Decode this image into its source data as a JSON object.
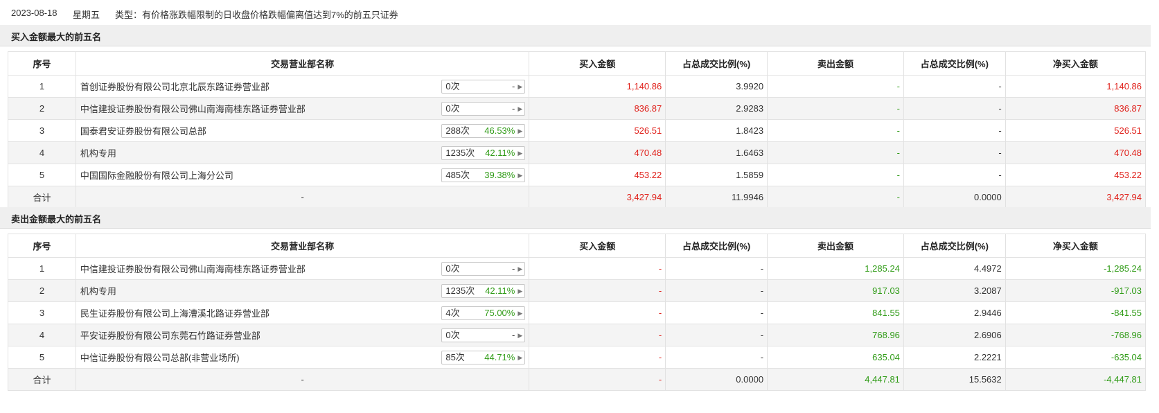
{
  "header": {
    "date": "2023-08-18",
    "weekday": "星期五",
    "type_text": "类型：有价格涨跌幅限制的日收盘价格跌幅偏离值达到7%的前五只证券"
  },
  "columns": [
    "序号",
    "交易营业部名称",
    "买入金额",
    "占总成交比例(%)",
    "卖出金额",
    "占总成交比例(%)",
    "净买入金额"
  ],
  "buy_section": {
    "title": "买入金额最大的前五名",
    "rows": [
      {
        "rank": "1",
        "name": "首创证券股份有限公司北京北辰东路证券营业部",
        "count": "0次",
        "pct": "-",
        "buy": "1,140.86",
        "buy_ratio": "3.9920",
        "sell": "-",
        "sell_ratio": "-",
        "net": "1,140.86"
      },
      {
        "rank": "2",
        "name": "中信建投证券股份有限公司佛山南海南桂东路证券营业部",
        "count": "0次",
        "pct": "-",
        "buy": "836.87",
        "buy_ratio": "2.9283",
        "sell": "-",
        "sell_ratio": "-",
        "net": "836.87"
      },
      {
        "rank": "3",
        "name": "国泰君安证券股份有限公司总部",
        "count": "288次",
        "pct": "46.53%",
        "buy": "526.51",
        "buy_ratio": "1.8423",
        "sell": "-",
        "sell_ratio": "-",
        "net": "526.51"
      },
      {
        "rank": "4",
        "name": "机构专用",
        "count": "1235次",
        "pct": "42.11%",
        "buy": "470.48",
        "buy_ratio": "1.6463",
        "sell": "-",
        "sell_ratio": "-",
        "net": "470.48"
      },
      {
        "rank": "5",
        "name": "中国国际金融股份有限公司上海分公司",
        "count": "485次",
        "pct": "39.38%",
        "buy": "453.22",
        "buy_ratio": "1.5859",
        "sell": "-",
        "sell_ratio": "-",
        "net": "453.22"
      }
    ],
    "total": {
      "label": "合计",
      "name": "-",
      "buy": "3,427.94",
      "buy_ratio": "11.9946",
      "sell": "-",
      "sell_ratio": "0.0000",
      "net": "3,427.94"
    }
  },
  "sell_section": {
    "title": "卖出金额最大的前五名",
    "rows": [
      {
        "rank": "1",
        "name": "中信建投证券股份有限公司佛山南海南桂东路证券营业部",
        "count": "0次",
        "pct": "-",
        "buy": "-",
        "buy_ratio": "-",
        "sell": "1,285.24",
        "sell_ratio": "4.4972",
        "net": "-1,285.24"
      },
      {
        "rank": "2",
        "name": "机构专用",
        "count": "1235次",
        "pct": "42.11%",
        "buy": "-",
        "buy_ratio": "-",
        "sell": "917.03",
        "sell_ratio": "3.2087",
        "net": "-917.03"
      },
      {
        "rank": "3",
        "name": "民生证券股份有限公司上海漕溪北路证券营业部",
        "count": "4次",
        "pct": "75.00%",
        "buy": "-",
        "buy_ratio": "-",
        "sell": "841.55",
        "sell_ratio": "2.9446",
        "net": "-841.55"
      },
      {
        "rank": "4",
        "name": "平安证券股份有限公司东莞石竹路证券营业部",
        "count": "0次",
        "pct": "-",
        "buy": "-",
        "buy_ratio": "-",
        "sell": "768.96",
        "sell_ratio": "2.6906",
        "net": "-768.96"
      },
      {
        "rank": "5",
        "name": "中信证券股份有限公司总部(非营业场所)",
        "count": "85次",
        "pct": "44.71%",
        "buy": "-",
        "buy_ratio": "-",
        "sell": "635.04",
        "sell_ratio": "2.2221",
        "net": "-635.04"
      }
    ],
    "total": {
      "label": "合计",
      "name": "-",
      "buy": "-",
      "buy_ratio": "0.0000",
      "sell": "4,447.81",
      "sell_ratio": "15.5632",
      "net": "-4,447.81"
    }
  },
  "colors": {
    "up": "#e0211b",
    "down": "#2f9b16",
    "header_bg": "#efefef",
    "row_alt": "#f4f4f4"
  },
  "icons": {
    "expand": "triangle-right-icon"
  }
}
